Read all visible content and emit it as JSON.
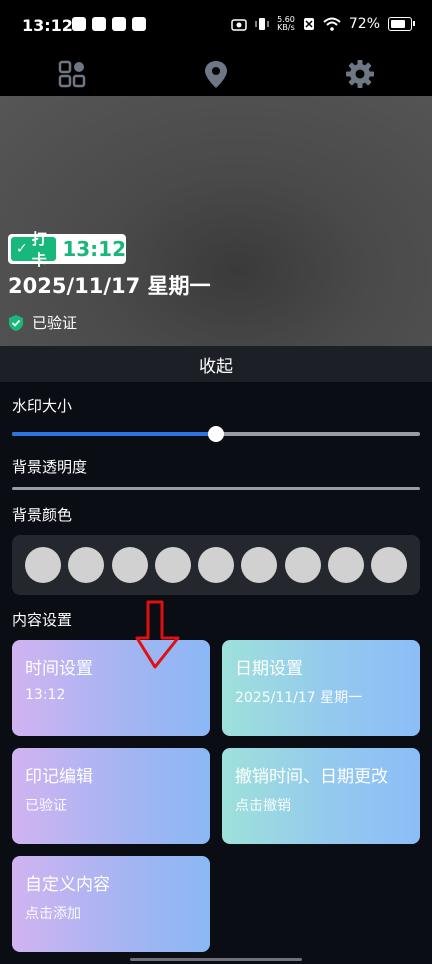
{
  "status_bar": {
    "time": "13:12",
    "speed_top": "5.60",
    "speed_bottom": "KB/s",
    "battery": "72%"
  },
  "nav": {
    "icons": [
      "apps-icon",
      "location-icon",
      "settings-icon"
    ]
  },
  "preview": {
    "punch_label": "打卡",
    "punch_time": "13:12",
    "date": "2025/11/17 星期一",
    "verified": "已验证",
    "accent": "#18b87a"
  },
  "collapse_label": "收起",
  "settings": {
    "watermark_size_label": "水印大小",
    "watermark_size_value": 0.5,
    "bg_opacity_label": "背景透明度",
    "bg_opacity_value": 0,
    "bg_color_label": "背景颜色",
    "bg_color_swatches": [
      "#d1d1d1",
      "#d1d1d1",
      "#d1d1d1",
      "#d1d1d1",
      "#d1d1d1",
      "#d1d1d1",
      "#d1d1d1",
      "#d1d1d1",
      "#d1d1d1"
    ],
    "content_label": "内容设置"
  },
  "cards": [
    {
      "title": "时间设置",
      "sub": "13:12"
    },
    {
      "title": "日期设置",
      "sub": "2025/11/17 星期一"
    },
    {
      "title": "印记编辑",
      "sub": "已验证"
    },
    {
      "title": "撤销时间、日期更改",
      "sub": "点击撤销"
    },
    {
      "title": "自定义内容",
      "sub": "点击添加"
    }
  ],
  "colors": {
    "slider_fill": "#2f73e0",
    "annotation_arrow": "#e01010"
  }
}
